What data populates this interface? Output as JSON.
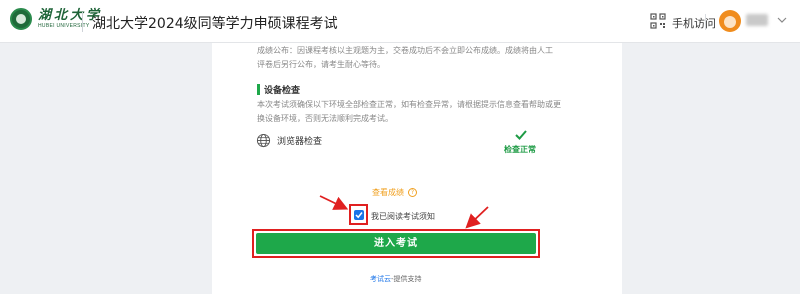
{
  "header": {
    "logo_cn": "湖北大学",
    "logo_en": "HUBEI UNIVERSITY",
    "title": "湖北大学2024级同等学力申硕课程考试",
    "mobile_access": "手机访问"
  },
  "notice": {
    "text": "成绩公布：因课程考核以主观题为主，交卷成功后不会立即公布成绩。成绩将由人工评卷后另行公布，请考生耐心等待。"
  },
  "device_check": {
    "title": "设备检查",
    "description": "本次考试须确保以下环境全部检查正常，如有检查异常，请根据提示信息查看帮助或更换设备环境，否则无法顺利完成考试。",
    "items": [
      {
        "label": "浏览器检查",
        "status": "检查正常",
        "icon": "globe-icon"
      }
    ]
  },
  "actions": {
    "view_results": "查看成绩",
    "agree_label": "我已阅读考试须知",
    "agree_checked": true,
    "enter_button": "进入考试"
  },
  "footer": {
    "link": "考试云",
    "suffix": "-提供支持"
  },
  "colors": {
    "accent_green": "#1ea84a",
    "highlight_red": "#e02020",
    "checkbox_blue": "#1a73e8",
    "warning_orange": "#f0a020"
  }
}
